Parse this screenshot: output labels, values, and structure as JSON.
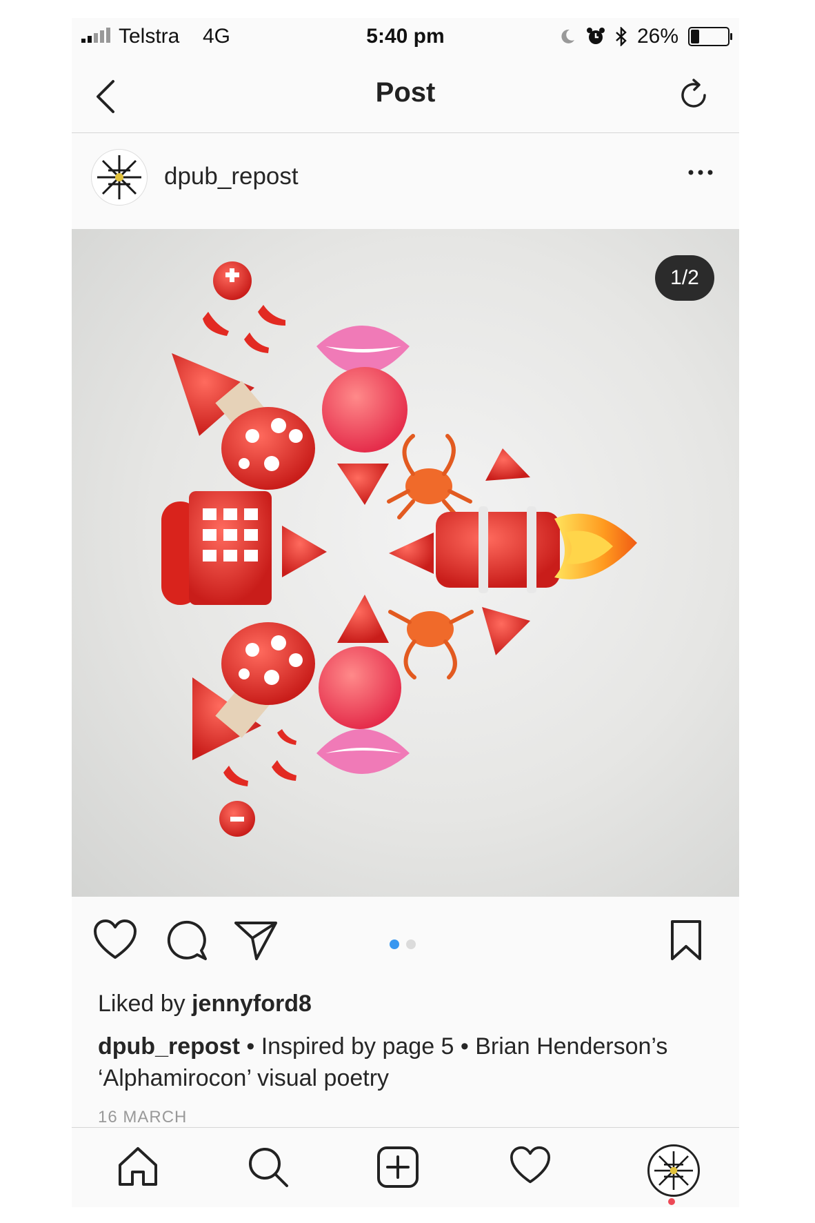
{
  "status_bar": {
    "carrier": "Telstra",
    "network": "4G",
    "time": "5:40 pm",
    "battery_text": "26%",
    "battery_level": 0.26,
    "icons": [
      "signal-icon",
      "moon-icon",
      "alarm-icon",
      "bluetooth-icon",
      "battery-icon"
    ]
  },
  "nav": {
    "title": "Post",
    "back_icon": "chevron-left-icon",
    "refresh_icon": "refresh-icon"
  },
  "post": {
    "username": "dpub_repost",
    "more_icon": "ellipsis-icon",
    "image_counter": "1/2",
    "carousel": {
      "count": 2,
      "active": 0
    },
    "liked_by_prefix": "Liked by ",
    "liked_by_user": "jennyford8",
    "caption_user": "dpub_repost",
    "caption_text": " • Inspired by page 5 • Brian Henderson’s ‘Alphamirocon’ visual poetry",
    "date": "16 MARCH"
  },
  "tabs": [
    "home-icon",
    "search-icon",
    "add-post-icon",
    "activity-heart-icon",
    "profile-avatar"
  ],
  "colors": {
    "accent_blue": "#3897f0",
    "notification_red": "#ed4956",
    "emoji_red": "#e8332d",
    "lip_pink": "#f07ab7"
  }
}
